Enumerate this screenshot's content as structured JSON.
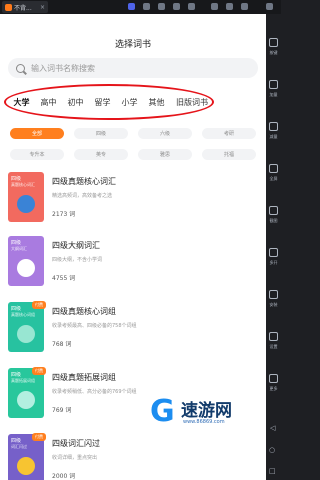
{
  "window": {
    "tab_label": "不背..."
  },
  "app": {
    "title": "选择词书",
    "search_placeholder": "输入词书名称搜索"
  },
  "categories": [
    "大学",
    "高中",
    "初中",
    "留学",
    "小学",
    "其他",
    "旧版词书"
  ],
  "filters": [
    "全部",
    "四级",
    "六级",
    "考研",
    "专升本",
    "英专",
    "雅思",
    "托福"
  ],
  "books": [
    {
      "title": "四级真题核心词汇",
      "desc": "精选高频词，高效备考之选",
      "count": "2173 词",
      "cover_title": "四级",
      "cover_sub": "真题核心词汇",
      "paid": "",
      "color": "#f26a5f",
      "mark": "#3a83d6"
    },
    {
      "title": "四级大纲词汇",
      "desc": "四级大纲，不含小学词",
      "count": "4755 词",
      "cover_title": "四级",
      "cover_sub": "大纲词汇",
      "paid": "",
      "color": "#a97be0",
      "mark": "#ffffff"
    },
    {
      "title": "四级真题核心词组",
      "desc": "收录考频最高、四级必备的758个词组",
      "count": "768 词",
      "cover_title": "四级",
      "cover_sub": "真题核心词组",
      "paid": "付费",
      "color": "#27c2a0",
      "mark": "#98e6d2"
    },
    {
      "title": "四级真题拓展词组",
      "desc": "收录考频稍低、高分必备的769个词组",
      "count": "769 词",
      "cover_title": "四级",
      "cover_sub": "真题拓展词组",
      "paid": "付费",
      "color": "#28c79c",
      "mark": "#b3efe0"
    },
    {
      "title": "四级词汇闪过",
      "desc": "收词详细，重点突出",
      "count": "2000 词",
      "cover_title": "四级",
      "cover_sub": "词汇闪过",
      "paid": "付费",
      "color": "#7660c9",
      "mark": "#f7c431"
    }
  ],
  "sidebar": [
    "按键",
    "加量",
    "减量",
    "全屏",
    "截图",
    "多开",
    "安装",
    "设置",
    "更多"
  ],
  "watermark": {
    "logo": "G",
    "text": "速游网",
    "url": "www.86869.com"
  }
}
